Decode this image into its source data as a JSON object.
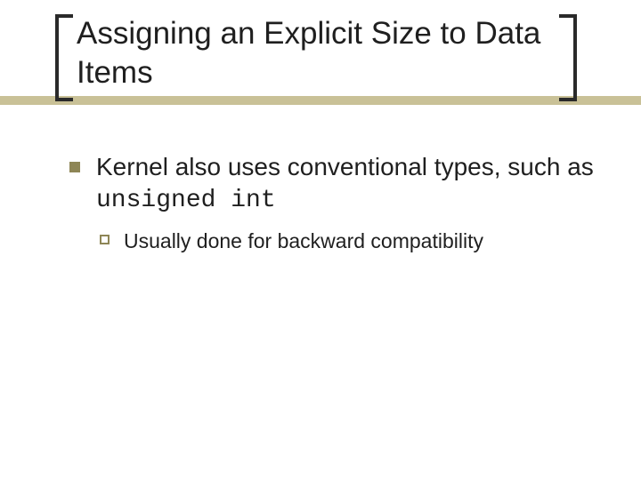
{
  "title": "Assigning an Explicit Size to Data Items",
  "bullets": {
    "l1": {
      "pre": "Kernel also uses conventional types, such as ",
      "code": "unsigned int"
    },
    "l2": "Usually done for backward compatibility"
  },
  "colors": {
    "accent_bar": "#c9c197",
    "bullet": "#8e8656",
    "bracket": "#2a2a2a"
  }
}
